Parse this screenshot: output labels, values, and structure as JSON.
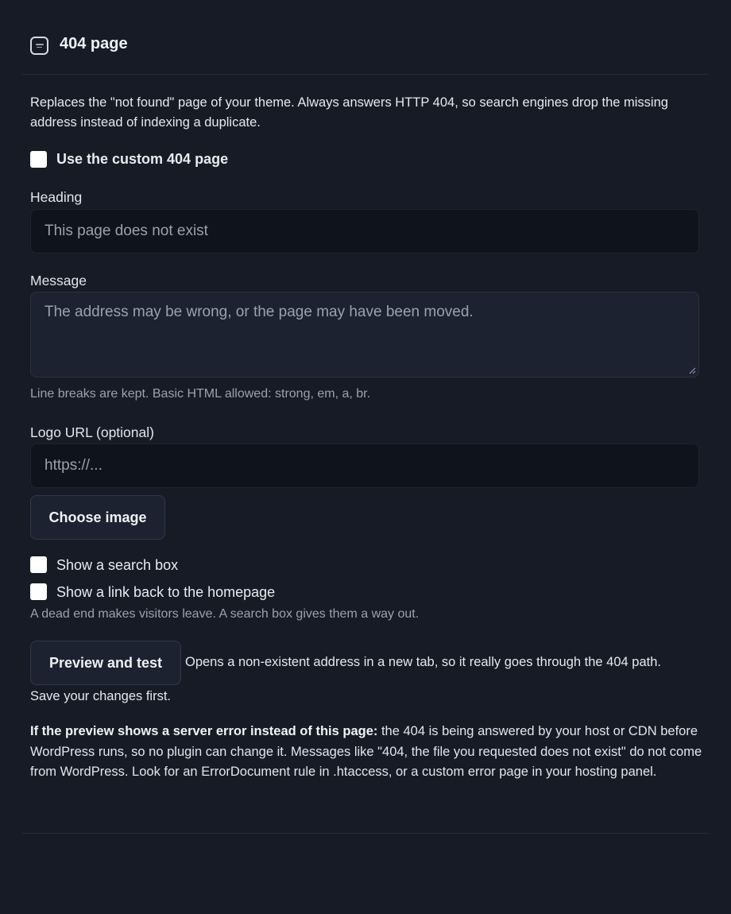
{
  "section": {
    "title": "404 page",
    "icon": "page-icon"
  },
  "description": "Replaces the \"not found\" page of your theme. Always answers HTTP 404, so search engines drop the missing address instead of indexing a duplicate.",
  "enable": {
    "label": "Use the custom 404 page",
    "checked": false
  },
  "heading": {
    "label": "Heading",
    "placeholder": "This page does not exist"
  },
  "message": {
    "label": "Message",
    "placeholder": "The address may be wrong, or the page may have been moved.",
    "hint": "Line breaks are kept. Basic HTML allowed: strong, em, a, br."
  },
  "logo": {
    "label": "Logo URL (optional)",
    "placeholder": "https://...",
    "choose_label": "Choose image"
  },
  "options": {
    "search_label": "Show a search box",
    "home_label": "Show a link back to the homepage",
    "hint": "A dead end makes visitors leave. A search box gives them a way out."
  },
  "preview": {
    "button_label": "Preview and test",
    "text_inline": "Opens a non-existent address in a new tab, so it really goes through the 404 path.",
    "text_after": "Save your changes first."
  },
  "note": {
    "bold": "If the preview shows a server error instead of this page:",
    "text": " the 404 is being answered by your host or CDN before WordPress runs, so no plugin can change it. Messages like \"404, the file you requested does not exist\" do not come from WordPress. Look for an ErrorDocument rule in .htaccess, or a custom error page in your hosting panel."
  },
  "colors": {
    "background": "#161b25",
    "input_bg": "#0f131b",
    "button_bg": "#1d2230",
    "text": "#dfe4ec",
    "muted": "#9aa2ae"
  }
}
